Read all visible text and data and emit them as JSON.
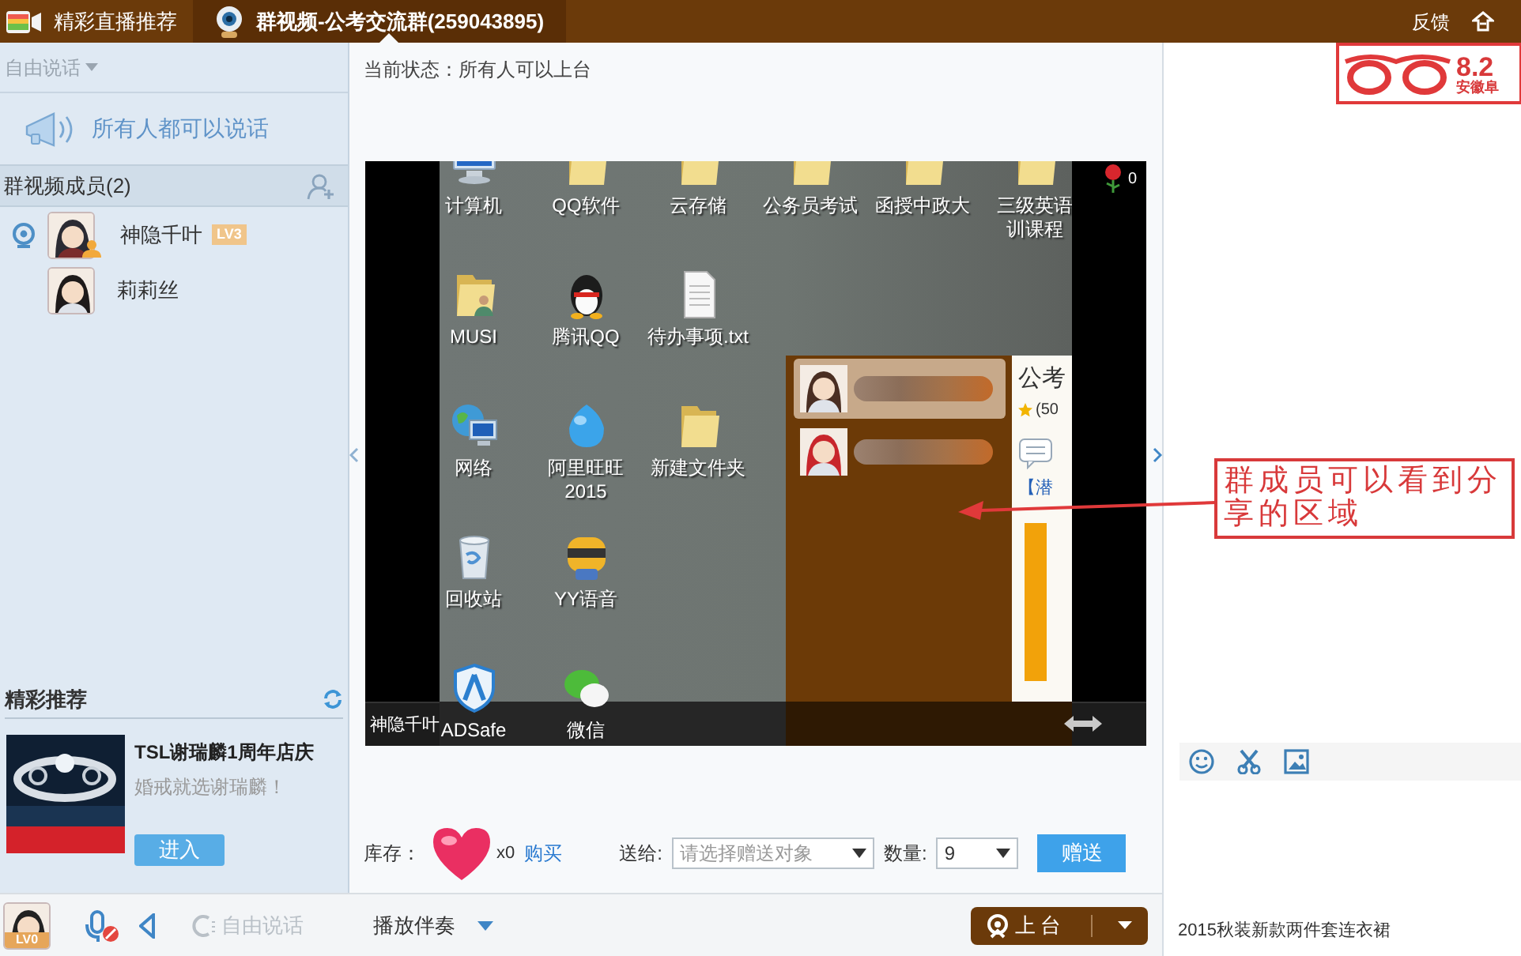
{
  "tabs": [
    {
      "label": "精彩直播推荐",
      "selected": false
    },
    {
      "label": "群视频-公考交流群(259043895)",
      "selected": true
    }
  ],
  "top_actions": {
    "feedback": "反馈"
  },
  "sidebar": {
    "talk_mode": "自由说话",
    "announcement": "所有人都可以说话",
    "members_title": "群视频成员(2)",
    "members": [
      {
        "name": "神隐千叶",
        "badge": "LV3",
        "on_camera": true,
        "host": true
      },
      {
        "name": "莉莉丝",
        "on_camera": false,
        "host": false
      }
    ],
    "recommend": {
      "title": "精彩推荐",
      "ad_title": "TSL谢瑞麟1周年店庆",
      "ad_subtitle": "婚戒就选谢瑞麟！",
      "ad_button": "进入"
    }
  },
  "stage": {
    "status": "当前状态：所有人可以上台",
    "presenter": "神隐千叶",
    "flowers": "0",
    "shared_desktop": {
      "icons": [
        {
          "kind": "computer",
          "label": "计算机"
        },
        {
          "kind": "folder",
          "label": "QQ软件"
        },
        {
          "kind": "folder",
          "label": "云存储"
        },
        {
          "kind": "folder",
          "label": "公务员考试"
        },
        {
          "kind": "folder",
          "label": "函授中政大"
        },
        {
          "kind": "folder",
          "lines": [
            "三级英语",
            "训课程"
          ]
        },
        {
          "kind": "user-folder",
          "label": "MUSI"
        },
        {
          "kind": "penguin",
          "label": "腾讯QQ"
        },
        {
          "kind": "file",
          "label": "待办事项.txt"
        },
        {
          "kind": "none"
        },
        {
          "kind": "none"
        },
        {
          "kind": "none"
        },
        {
          "kind": "globe",
          "label": "网络"
        },
        {
          "kind": "drop",
          "lines": [
            "阿里旺旺",
            "2015"
          ]
        },
        {
          "kind": "folder",
          "label": "新建文件夹"
        },
        {
          "kind": "none"
        },
        {
          "kind": "none"
        },
        {
          "kind": "none"
        },
        {
          "kind": "trash",
          "label": "回收站"
        },
        {
          "kind": "app",
          "label": "YY语音"
        },
        {
          "kind": "none"
        },
        {
          "kind": "none"
        },
        {
          "kind": "none"
        },
        {
          "kind": "none"
        },
        {
          "kind": "shield",
          "label": "ADSafe"
        },
        {
          "kind": "chat",
          "label": "微信"
        }
      ],
      "chat_window": {
        "contacts": [
          {
            "selected": true
          },
          {
            "selected": false
          }
        ],
        "group_title": "公考",
        "group_count": "(50",
        "notice": "【潜"
      }
    }
  },
  "gift_bar": {
    "stock_label": "库存：",
    "count": "x0",
    "buy": "购买",
    "send_to_label": "送给:",
    "send_to_placeholder": "请选择赠送对象",
    "quantity_label": "数量:",
    "quantity": "9",
    "send": "赠送"
  },
  "bottom_bar": {
    "user_badge": "LV0",
    "talk_mode": "自由说话",
    "accompaniment": "播放伴奏",
    "go_on_stage": "上台"
  },
  "chat": {
    "ad_price": "8.2",
    "ad_place": "安徽阜",
    "footer": "2015秋装新款两件套连衣裙"
  },
  "annotation": {
    "text": "群成员可以看到分享的区域"
  }
}
